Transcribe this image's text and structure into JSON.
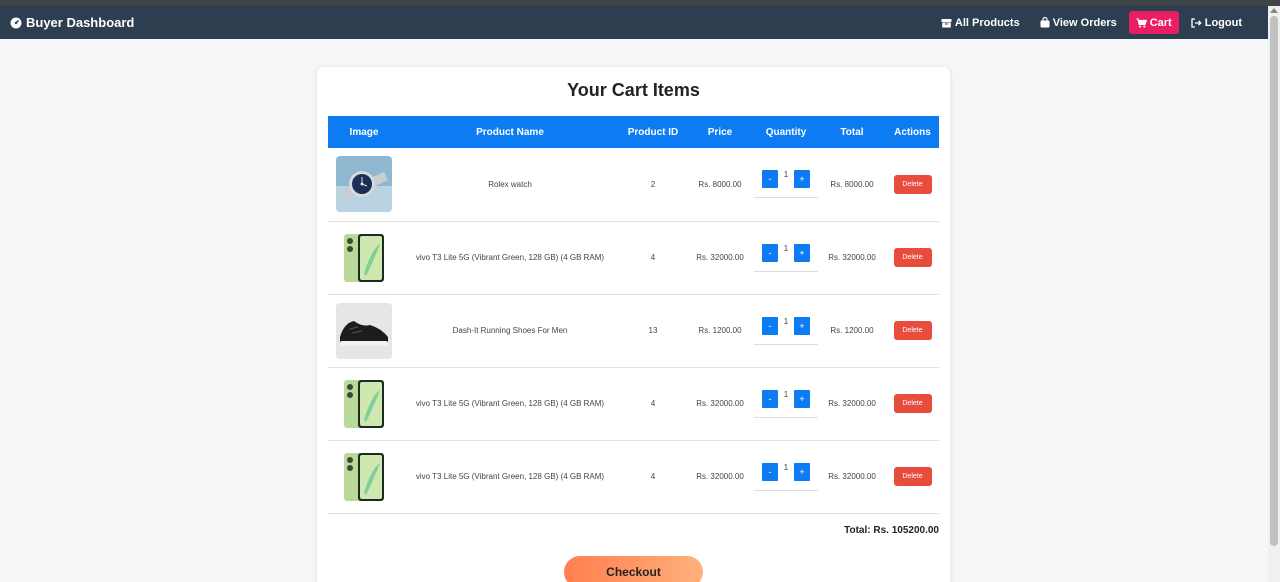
{
  "navbar": {
    "brand": "Buyer Dashboard",
    "links": [
      {
        "label": "All Products"
      },
      {
        "label": "View Orders"
      },
      {
        "label": "Cart"
      },
      {
        "label": "Logout"
      }
    ],
    "active_color": "#e91e63",
    "bg_color": "#2c3e50"
  },
  "cart": {
    "title": "Your Cart Items",
    "headers": [
      "Image",
      "Product Name",
      "Product ID",
      "Price",
      "Quantity",
      "Total",
      "Actions"
    ],
    "items": [
      {
        "image": "watch-image",
        "name": "Rolex watch",
        "product_id": "2",
        "price": "Rs. 8000.00",
        "qty": "1",
        "total": "Rs. 8000.00",
        "action": "Delete"
      },
      {
        "image": "phone-image",
        "name": "vivo T3 Lite 5G (Vibrant Green, 128 GB) (4 GB RAM)",
        "product_id": "4",
        "price": "Rs. 32000.00",
        "qty": "1",
        "total": "Rs. 32000.00",
        "action": "Delete"
      },
      {
        "image": "shoe-image",
        "name": "Dash-It Running Shoes For Men",
        "product_id": "13",
        "price": "Rs. 1200.00",
        "qty": "1",
        "total": "Rs. 1200.00",
        "action": "Delete"
      },
      {
        "image": "phone-image",
        "name": "vivo T3 Lite 5G (Vibrant Green, 128 GB) (4 GB RAM)",
        "product_id": "4",
        "price": "Rs. 32000.00",
        "qty": "1",
        "total": "Rs. 32000.00",
        "action": "Delete"
      },
      {
        "image": "phone-image",
        "name": "vivo T3 Lite 5G (Vibrant Green, 128 GB) (4 GB RAM)",
        "product_id": "4",
        "price": "Rs. 32000.00",
        "qty": "1",
        "total": "Rs. 32000.00",
        "action": "Delete"
      }
    ],
    "qty_minus": "-",
    "qty_plus": "+",
    "grand_total": "Total: Rs. 105200.00",
    "checkout_label": "Checkout",
    "header_color": "#0d7cf2",
    "delete_color": "#e74c3c"
  }
}
